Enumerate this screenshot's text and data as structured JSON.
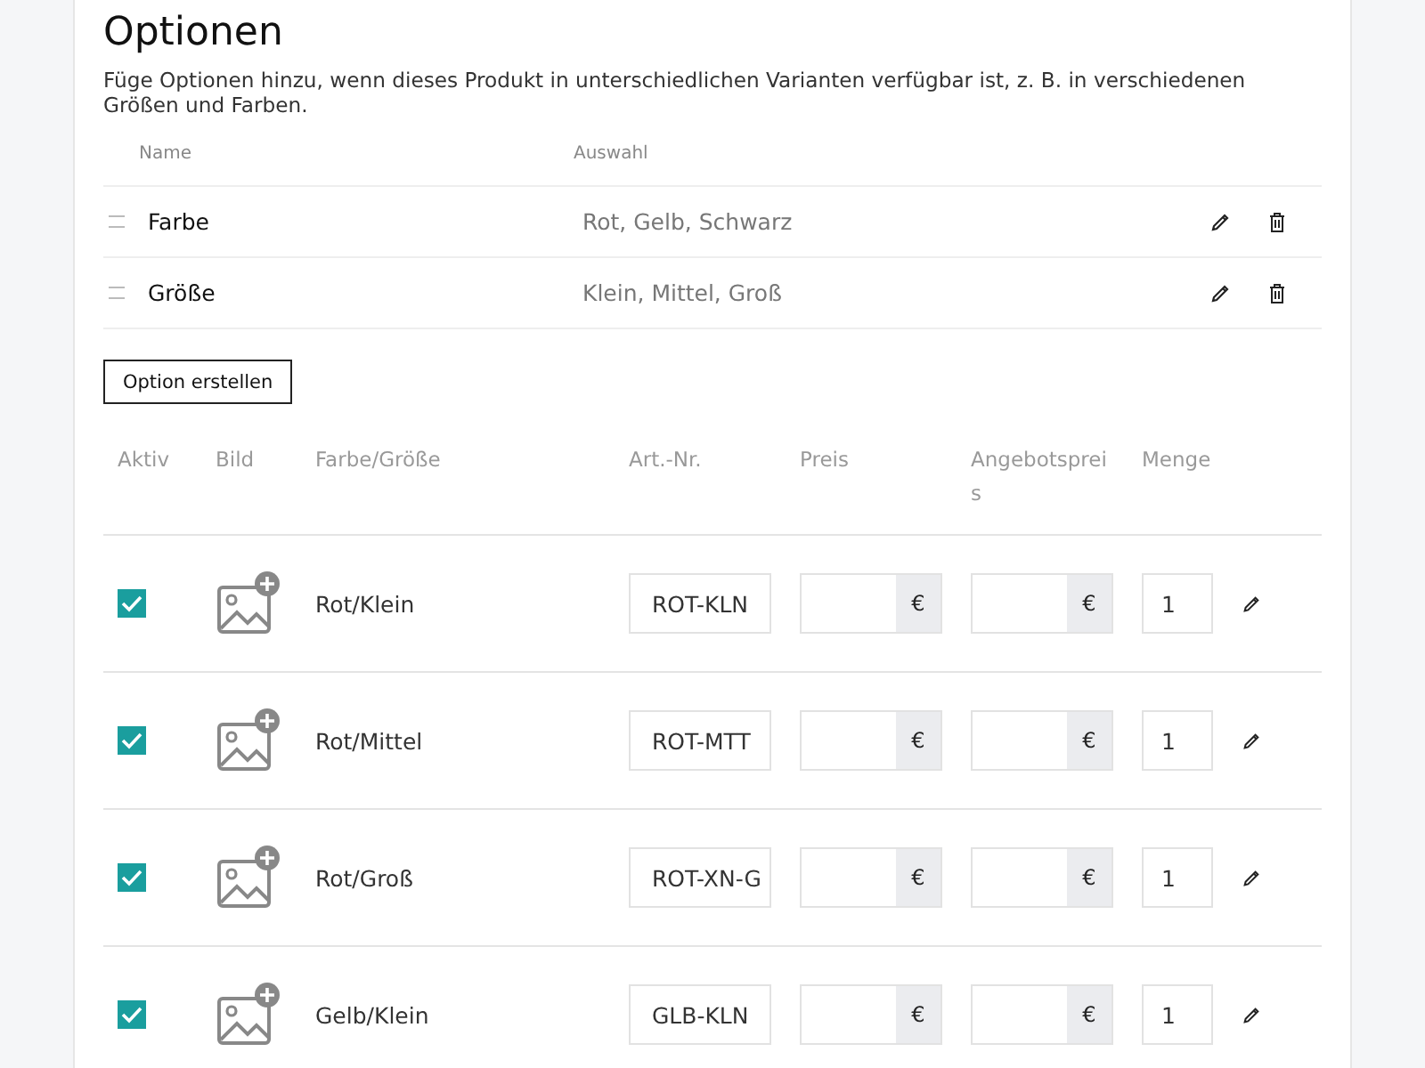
{
  "section": {
    "title": "Optionen",
    "description": "Füge Optionen hinzu, wenn dieses Produkt in unterschiedlichen Varianten verfügbar ist, z. B. in verschiedenen Größen und Farben."
  },
  "options_table": {
    "columns": [
      "Name",
      "Auswahl"
    ],
    "rows": [
      {
        "name": "Farbe",
        "values": "Rot, Gelb, Schwarz"
      },
      {
        "name": "Größe",
        "values": "Klein, Mittel, Groß"
      }
    ]
  },
  "create_button": "Option erstellen",
  "variants_table": {
    "columns": [
      "Aktiv",
      "Bild",
      "Farbe/Größe",
      "Art.-Nr.",
      "Preis",
      "Angebotspreis",
      "Menge"
    ],
    "currency": "€",
    "rows": [
      {
        "active": true,
        "variant": "Rot/Klein",
        "sku": "ROT-KLN",
        "quantity": "1"
      },
      {
        "active": true,
        "variant": "Rot/Mittel",
        "sku": "ROT-MTT",
        "quantity": "1"
      },
      {
        "active": true,
        "variant": "Rot/Groß",
        "sku": "ROT-XN-G",
        "quantity": "1"
      },
      {
        "active": true,
        "variant": "Gelb/Klein",
        "sku": "GLB-KLN",
        "quantity": "1"
      }
    ]
  }
}
